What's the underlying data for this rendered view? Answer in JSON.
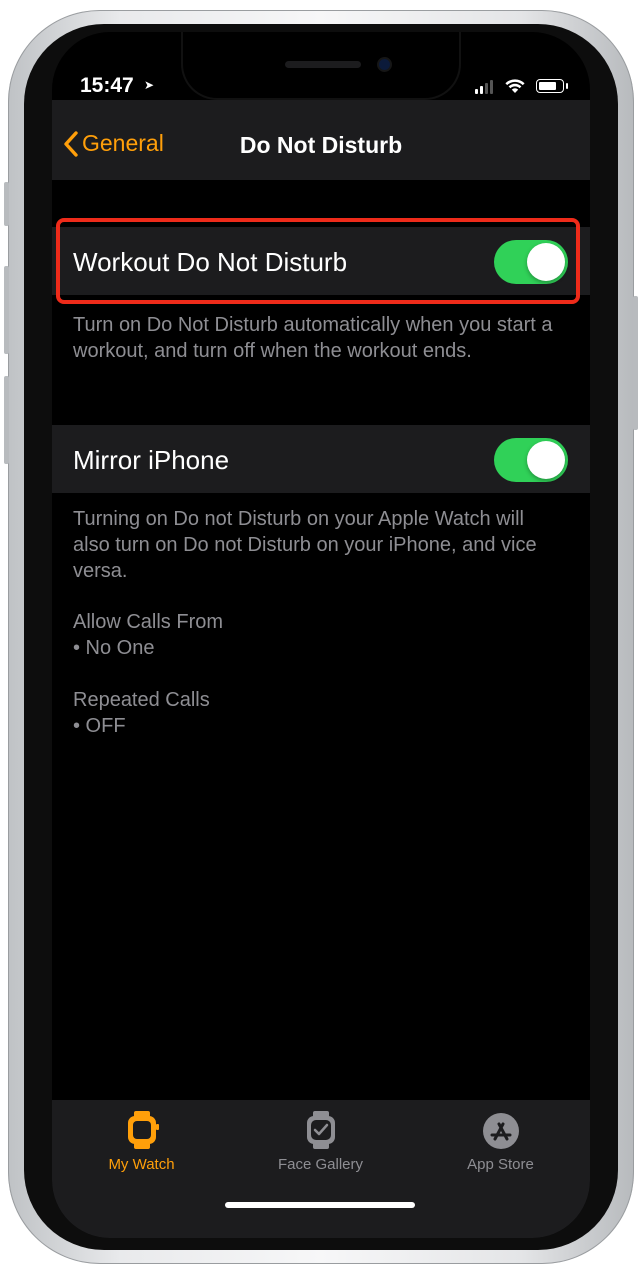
{
  "status_bar": {
    "time": "15:47"
  },
  "nav": {
    "back_label": "General",
    "title": "Do Not Disturb"
  },
  "workout_dnd": {
    "label": "Workout Do Not Disturb",
    "enabled": true,
    "footer": "Turn on Do Not Disturb automatically when you start a workout, and turn off when the workout ends."
  },
  "mirror_iphone": {
    "label": "Mirror iPhone",
    "enabled": true,
    "footer": "Turning on Do not Disturb on your Apple Watch will also turn on Do not Disturb on your iPhone, and vice versa."
  },
  "allow_calls": {
    "title": "Allow Calls From",
    "value": "• No One"
  },
  "repeated_calls": {
    "title": "Repeated Calls",
    "value": "• OFF"
  },
  "tabs": [
    {
      "label": "My Watch",
      "icon": "watch-icon",
      "active": true
    },
    {
      "label": "Face Gallery",
      "icon": "watch-face-icon",
      "active": false
    },
    {
      "label": "App Store",
      "icon": "app-store-icon",
      "active": false
    }
  ],
  "colors": {
    "accent": "#ff9f0a",
    "toggle_on": "#30d158",
    "highlight": "#ee2b1a"
  }
}
